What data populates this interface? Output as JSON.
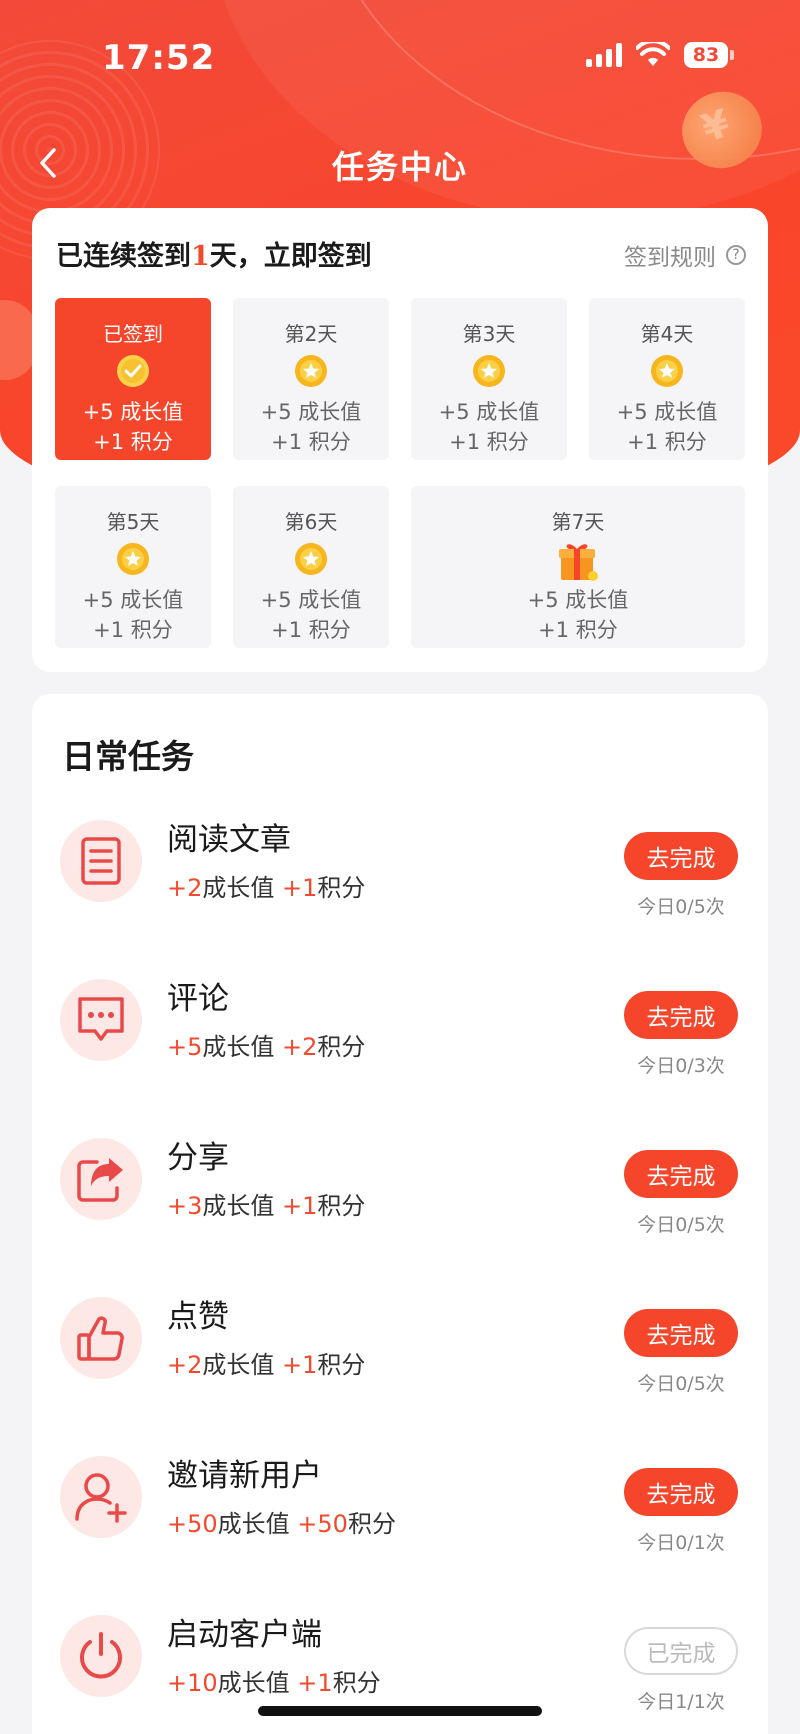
{
  "status_bar": {
    "time": "17:52",
    "battery": "83"
  },
  "header": {
    "title": "任务中心"
  },
  "signin": {
    "title_prefix": "已连续签到",
    "title_days": "1",
    "title_suffix": "天，立即签到",
    "rules_label": "签到规则",
    "rules_icon": "?",
    "days": [
      {
        "label": "已签到",
        "growth": "+5  成长值",
        "points": "+1  积分",
        "state": "done",
        "icon": "check-coin-icon"
      },
      {
        "label": "第2天",
        "growth": "+5  成长值",
        "points": "+1  积分",
        "state": "pending",
        "icon": "star-coin-icon"
      },
      {
        "label": "第3天",
        "growth": "+5  成长值",
        "points": "+1  积分",
        "state": "pending",
        "icon": "star-coin-icon"
      },
      {
        "label": "第4天",
        "growth": "+5  成长值",
        "points": "+1  积分",
        "state": "pending",
        "icon": "star-coin-icon"
      },
      {
        "label": "第5天",
        "growth": "+5  成长值",
        "points": "+1  积分",
        "state": "pending",
        "icon": "star-coin-icon"
      },
      {
        "label": "第6天",
        "growth": "+5  成长值",
        "points": "+1  积分",
        "state": "pending",
        "icon": "star-coin-icon"
      },
      {
        "label": "第7天",
        "growth": "+5  成长值",
        "points": "+1  积分",
        "state": "pending",
        "icon": "gift-icon"
      }
    ]
  },
  "tasks": {
    "title": "日常任务",
    "growth_unit": "成长值",
    "points_unit": "积分",
    "items": [
      {
        "name": "阅读文章",
        "growth": "+2",
        "points": "+1",
        "button": "去完成",
        "count": "今日0/5次",
        "icon": "article-icon"
      },
      {
        "name": "评论",
        "growth": "+5",
        "points": "+2",
        "button": "去完成",
        "count": "今日0/3次",
        "icon": "comment-icon"
      },
      {
        "name": "分享",
        "growth": "+3",
        "points": "+1",
        "button": "去完成",
        "count": "今日0/5次",
        "icon": "share-icon"
      },
      {
        "name": "点赞",
        "growth": "+2",
        "points": "+1",
        "button": "去完成",
        "count": "今日0/5次",
        "icon": "thumbs-up-icon"
      },
      {
        "name": "邀请新用户",
        "growth": "+50",
        "points": "+50",
        "button": "去完成",
        "count": "今日0/1次",
        "icon": "add-user-icon"
      },
      {
        "name": "启动客户端",
        "growth": "+10",
        "points": "+1",
        "button": "已完成",
        "count": "今日1/1次",
        "icon": "power-icon"
      }
    ]
  },
  "colors": {
    "accent": "#f5452a",
    "icon_bg": "#fde8e6",
    "icon_stroke": "#e84a4a",
    "coin": "#f5b820"
  }
}
